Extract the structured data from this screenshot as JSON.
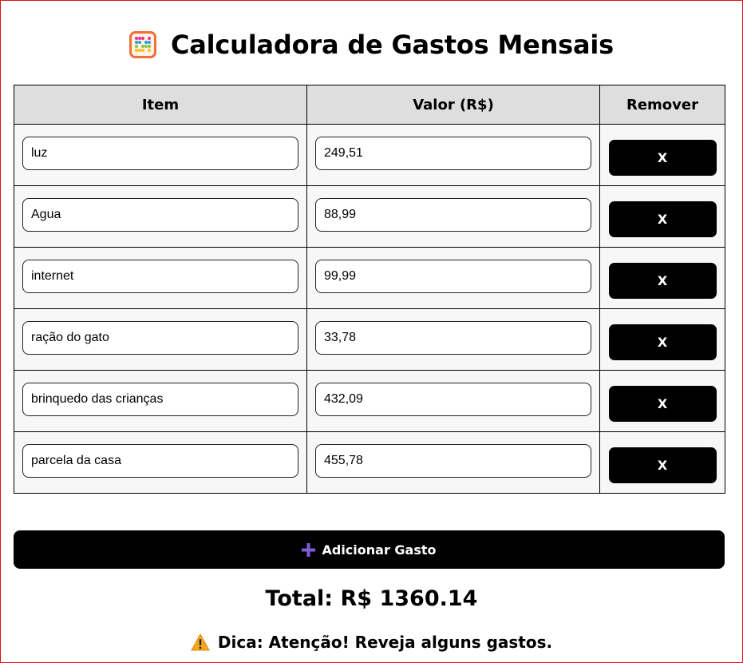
{
  "header": {
    "title": "Calculadora de Gastos Mensais",
    "icon": "abacus-icon"
  },
  "table": {
    "columns": [
      "Item",
      "Valor (R$)",
      "Remover"
    ],
    "rows": [
      {
        "item": "luz",
        "valor": "249,51",
        "remove_label": "X"
      },
      {
        "item": "Agua",
        "valor": "88,99",
        "remove_label": "X"
      },
      {
        "item": "internet",
        "valor": "99,99",
        "remove_label": "X"
      },
      {
        "item": "ração do gato",
        "valor": "33,78",
        "remove_label": "X"
      },
      {
        "item": "brinquedo das crianças",
        "valor": "432,09",
        "remove_label": "X"
      },
      {
        "item": "parcela da casa",
        "valor": "455,78",
        "remove_label": "X"
      }
    ]
  },
  "actions": {
    "add_label": "Adicionar Gasto",
    "add_icon": "plus-icon"
  },
  "summary": {
    "total": "Total: R$ 1360.14",
    "tip": "Dica: Atenção! Reveja alguns gastos.",
    "tip_icon": "warning-icon"
  },
  "colors": {
    "border_frame": "#e10f0f",
    "button_bg": "#000000",
    "header_bg": "#dedede",
    "cell_bg": "#f7f7f7",
    "plus_accent": "#7b5cd6",
    "warning": "#f5a623"
  }
}
